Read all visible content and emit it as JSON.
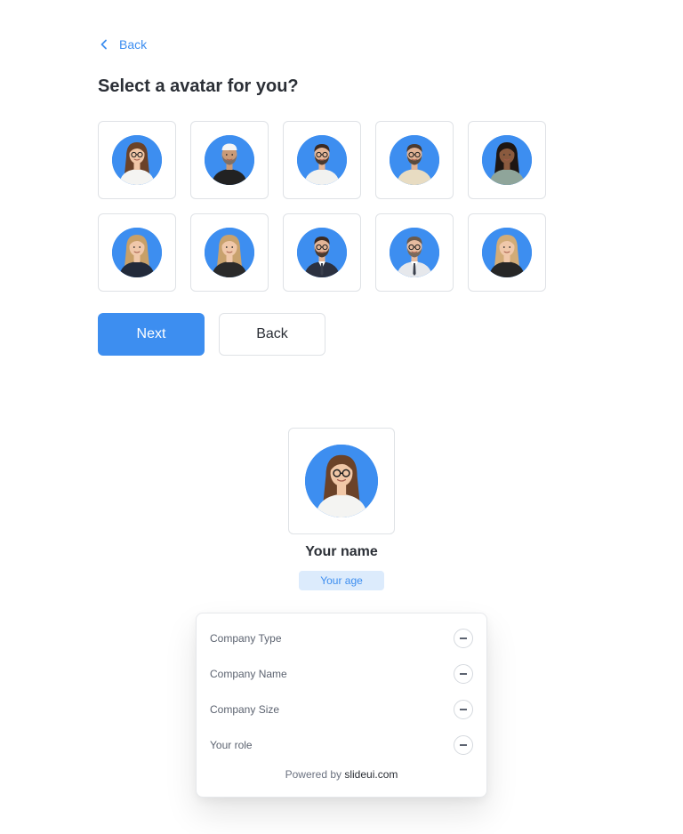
{
  "nav": {
    "back_label": "Back"
  },
  "title": "Select a avatar for you?",
  "avatars": [
    {
      "name": "woman-glasses-white-shirt",
      "skin": "#f1c7a6",
      "hair": "#6b4228",
      "shirt": "#f4f4f2",
      "glasses": true,
      "long_hair": true,
      "beard": false,
      "tie": false,
      "cap": false
    },
    {
      "name": "man-beard-white-cap",
      "skin": "#c99a78",
      "hair": "#f5f5f5",
      "shirt": "#222222",
      "glasses": false,
      "long_hair": false,
      "beard": true,
      "beard_color": "#7d7068",
      "tie": false,
      "cap": true
    },
    {
      "name": "man-glasses-white-shirt",
      "skin": "#e5b798",
      "hair": "#3b2a22",
      "shirt": "#f2f2f0",
      "glasses": true,
      "long_hair": false,
      "beard": true,
      "beard_color": "#4a3a30",
      "tie": false,
      "cap": false
    },
    {
      "name": "man-glasses-beige-shirt",
      "skin": "#e0b294",
      "hair": "#4a3a30",
      "shirt": "#e8dcc2",
      "glasses": true,
      "long_hair": false,
      "beard": true,
      "beard_color": "#5a4a3c",
      "tie": false,
      "cap": false
    },
    {
      "name": "woman-curly-green-shirt",
      "skin": "#8a5a3e",
      "hair": "#1e1612",
      "shirt": "#8fa59a",
      "glasses": false,
      "long_hair": true,
      "beard": false,
      "tie": false,
      "cap": false
    },
    {
      "name": "woman-blonde-black-blazer",
      "skin": "#f0c8aa",
      "hair": "#c8a068",
      "shirt": "#222a3a",
      "glasses": false,
      "long_hair": true,
      "beard": false,
      "tie": false,
      "cap": false
    },
    {
      "name": "woman-blonde-dark-blazer",
      "skin": "#f0c8aa",
      "hair": "#c8a26e",
      "shirt": "#2a2a2a",
      "glasses": false,
      "long_hair": true,
      "beard": false,
      "tie": false,
      "cap": false
    },
    {
      "name": "man-glasses-suit-tie",
      "skin": "#e3b597",
      "hair": "#3b2a22",
      "shirt": "#2c3140",
      "glasses": true,
      "long_hair": false,
      "beard": true,
      "beard_color": "#4a3a30",
      "tie": true,
      "cap": false
    },
    {
      "name": "man-glasses-white-shirt-tie",
      "skin": "#e6bca0",
      "hair": "#6a5a4c",
      "shirt": "#e6e8ec",
      "glasses": true,
      "long_hair": false,
      "beard": true,
      "beard_color": "#7a6a5c",
      "tie": true,
      "cap": false
    },
    {
      "name": "woman-blonde-black-suit",
      "skin": "#f0c8aa",
      "hair": "#d2ac78",
      "shirt": "#262626",
      "glasses": false,
      "long_hair": true,
      "beard": false,
      "tie": false,
      "cap": false
    }
  ],
  "buttons": {
    "next_label": "Next",
    "back_label": "Back"
  },
  "selected_avatar_index": 0,
  "profile": {
    "name_label": "Your name",
    "age_label": "Your age"
  },
  "details": [
    {
      "label": "Company Type"
    },
    {
      "label": "Company Name"
    },
    {
      "label": "Company Size"
    },
    {
      "label": "Your role"
    }
  ],
  "footer": {
    "prefix": "Powered by",
    "brand": "slideui.com"
  },
  "colors": {
    "accent": "#3d8ef0",
    "age_badge_bg": "#dcebfc",
    "border": "#dfe2e6"
  }
}
